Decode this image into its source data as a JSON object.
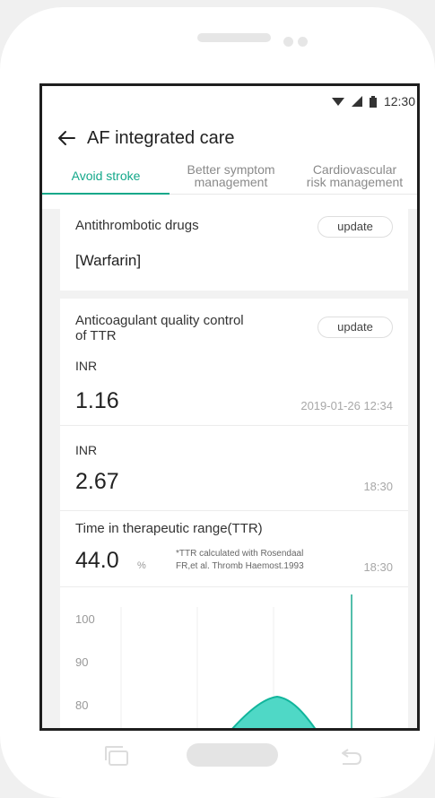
{
  "status": {
    "time": "12:30"
  },
  "header": {
    "title": "AF integrated care"
  },
  "tabs": [
    {
      "label": "Avoid stroke"
    },
    {
      "line1": "Better symptom",
      "line2": "management"
    },
    {
      "line1": "Cardiovascular",
      "line2": "risk management"
    }
  ],
  "antithrombotic": {
    "label": "Antithrombotic drugs",
    "update_label": "update",
    "value": "[Warfarin]"
  },
  "anticoag": {
    "label_line1": "Anticoagulant quality control",
    "label_line2": "of TTR",
    "update_label": "update",
    "readings": [
      {
        "label": "INR",
        "value": "1.16",
        "time": "2019-01-26 12:34"
      },
      {
        "label": "INR",
        "value": "2.67",
        "time": "18:30"
      }
    ],
    "ttr": {
      "label": "Time in therapeutic range(TTR)",
      "value": "44.0",
      "unit": "%",
      "note_line1": "*TTR calculated with Rosendaal",
      "note_line2": "FR,et al. Thromb Haemost.1993",
      "time": "18:30"
    }
  },
  "chart_data": {
    "type": "area",
    "y_ticks": [
      "100",
      "90",
      "80"
    ],
    "color": "#4fd8c6"
  },
  "icons": [
    "back-arrow-icon",
    "wifi-icon",
    "signal-icon",
    "battery-icon",
    "recent-apps-icon",
    "home-button",
    "back-nav-icon"
  ]
}
